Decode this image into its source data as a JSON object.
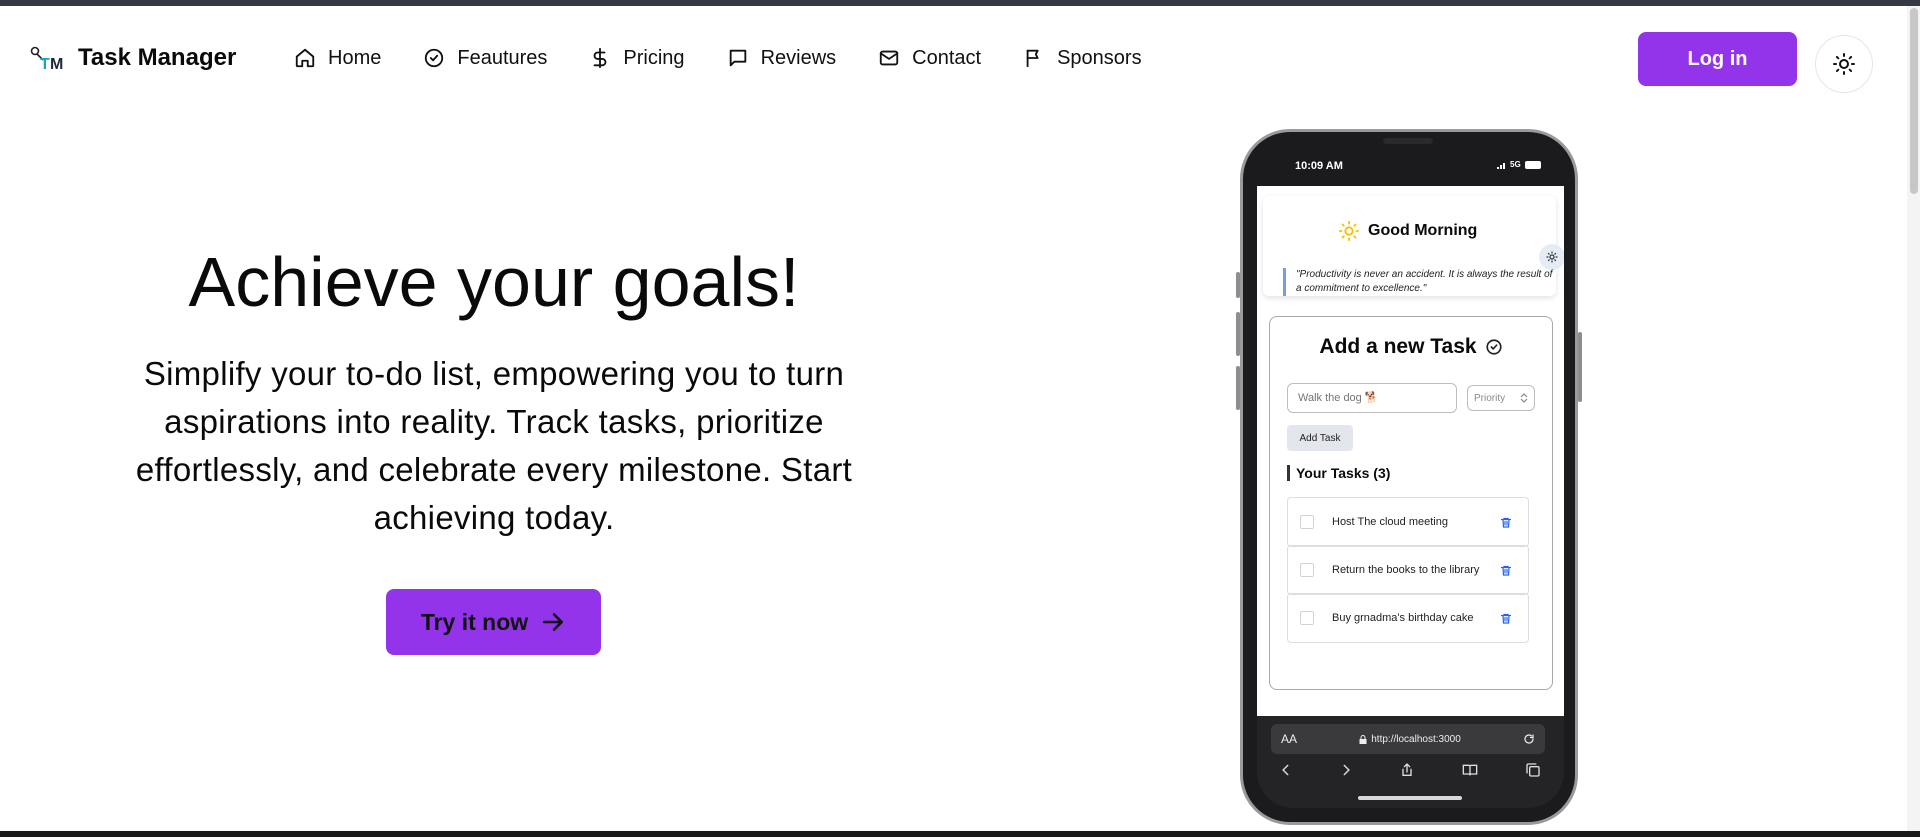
{
  "brand": {
    "name": "Task Manager",
    "logo_text": "TM"
  },
  "nav": {
    "items": [
      {
        "label": "Home",
        "icon": "home-icon"
      },
      {
        "label": "Feautures",
        "icon": "check-circle-icon"
      },
      {
        "label": "Pricing",
        "icon": "dollar-icon"
      },
      {
        "label": "Reviews",
        "icon": "message-icon"
      },
      {
        "label": "Contact",
        "icon": "mail-icon"
      },
      {
        "label": "Sponsors",
        "icon": "flag-icon"
      }
    ],
    "login_label": "Log in"
  },
  "hero": {
    "title": "Achieve your goals!",
    "subtitle": "Simplify your to-do list, empowering you to turn aspirations into reality. Track tasks, prioritize effortlessly, and celebrate every milestone. Start achieving today.",
    "cta_label": "Try it now"
  },
  "phone": {
    "status_time": "10:09 AM",
    "status_network": "5G",
    "greeting": "Good Morning",
    "quote": "\"Productivity is never an accident. It is always the result of a commitment to excellence.\"",
    "task_card": {
      "title": "Add a new Task",
      "input_placeholder": "Walk the dog 🐕",
      "priority_placeholder": "Priority",
      "add_label": "Add Task",
      "list_heading": "Your Tasks (3)",
      "tasks": [
        {
          "text": "Host The cloud meeting"
        },
        {
          "text": "Return the books to the library"
        },
        {
          "text": "Buy grnadma's birthday cake"
        }
      ]
    },
    "browser": {
      "aa": "AA",
      "url": "http://localhost:3000"
    }
  },
  "colors": {
    "accent": "#9333ea",
    "trash": "#2563eb"
  }
}
